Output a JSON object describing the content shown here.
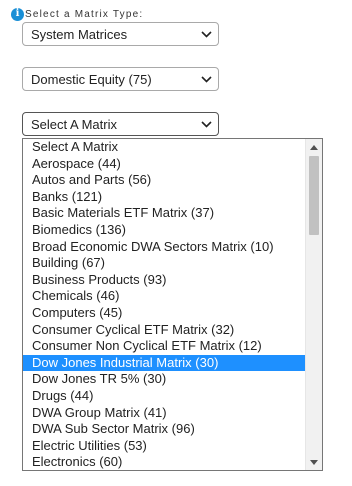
{
  "header": {
    "info_icon_glyph": "i",
    "label": "Select a Matrix Type:"
  },
  "type_select": {
    "value": "System Matrices"
  },
  "subtype_select": {
    "value": "Domestic Equity (75)"
  },
  "matrix_select": {
    "value": "Select A Matrix",
    "selected_option": "Dow Jones Industrial Matrix (30)",
    "options": [
      "Select A Matrix",
      "Aerospace (44)",
      "Autos and Parts (56)",
      "Banks (121)",
      "Basic Materials ETF Matrix (37)",
      "Biomedics (136)",
      "Broad Economic DWA Sectors Matrix (10)",
      "Building (67)",
      "Business Products (93)",
      "Chemicals (46)",
      "Computers (45)",
      "Consumer Cyclical ETF Matrix (32)",
      "Consumer Non Cyclical ETF Matrix (12)",
      "Dow Jones Industrial Matrix (30)",
      "Dow Jones TR 5% (30)",
      "Drugs (44)",
      "DWA Group Matrix (41)",
      "DWA Sub Sector Matrix (96)",
      "Electric Utilities (53)",
      "Electronics (60)"
    ]
  },
  "icons": {
    "chevron": "chevron-down-icon",
    "scroll_up": "scroll-up-arrow-icon",
    "scroll_down": "scroll-down-arrow-icon"
  },
  "colors": {
    "info_icon": "#1a8fd6",
    "selected_option_bg": "#1e90ff",
    "selected_option_text": "#ffffff"
  }
}
